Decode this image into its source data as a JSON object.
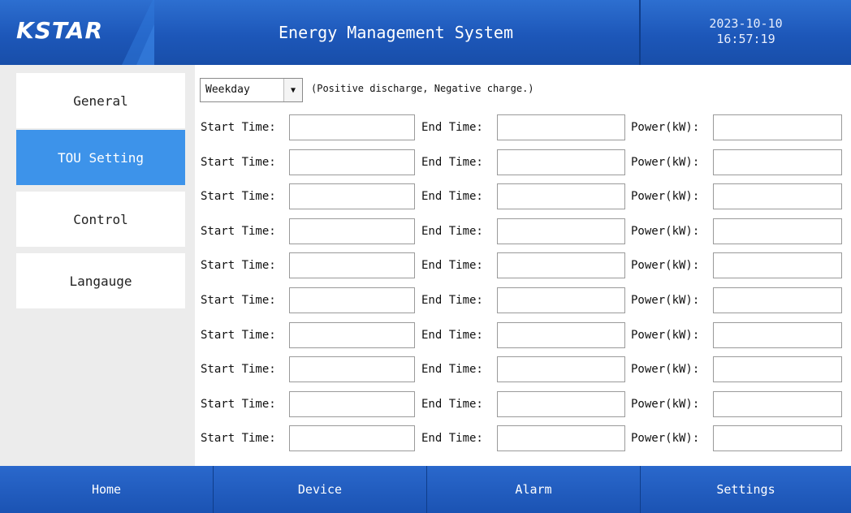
{
  "header": {
    "logo": "KSTAR",
    "title": "Energy Management System",
    "date": "2023-10-10",
    "time": "16:57:19"
  },
  "sidebar": {
    "items": [
      {
        "label": "General",
        "active": false
      },
      {
        "label": "TOU Setting",
        "active": true
      },
      {
        "label": "Control",
        "active": false
      },
      {
        "label": "Langauge",
        "active": false
      }
    ]
  },
  "tou": {
    "mode": "Weekday",
    "hint": "(Positive discharge, Negative charge.)",
    "start_label": "Start Time:",
    "end_label": "End Time:",
    "power_label": "Power(kW):",
    "rows": [
      {
        "start": "",
        "end": "",
        "power": ""
      },
      {
        "start": "",
        "end": "",
        "power": ""
      },
      {
        "start": "",
        "end": "",
        "power": ""
      },
      {
        "start": "",
        "end": "",
        "power": ""
      },
      {
        "start": "",
        "end": "",
        "power": ""
      },
      {
        "start": "",
        "end": "",
        "power": ""
      },
      {
        "start": "",
        "end": "",
        "power": ""
      },
      {
        "start": "",
        "end": "",
        "power": ""
      },
      {
        "start": "",
        "end": "",
        "power": ""
      },
      {
        "start": "",
        "end": "",
        "power": ""
      }
    ]
  },
  "footer": {
    "tabs": [
      "Home",
      "Device",
      "Alarm",
      "Settings"
    ]
  },
  "colors": {
    "header_blue": "#1d57b9",
    "active_tab": "#3d93ea",
    "background": "#ececec"
  }
}
